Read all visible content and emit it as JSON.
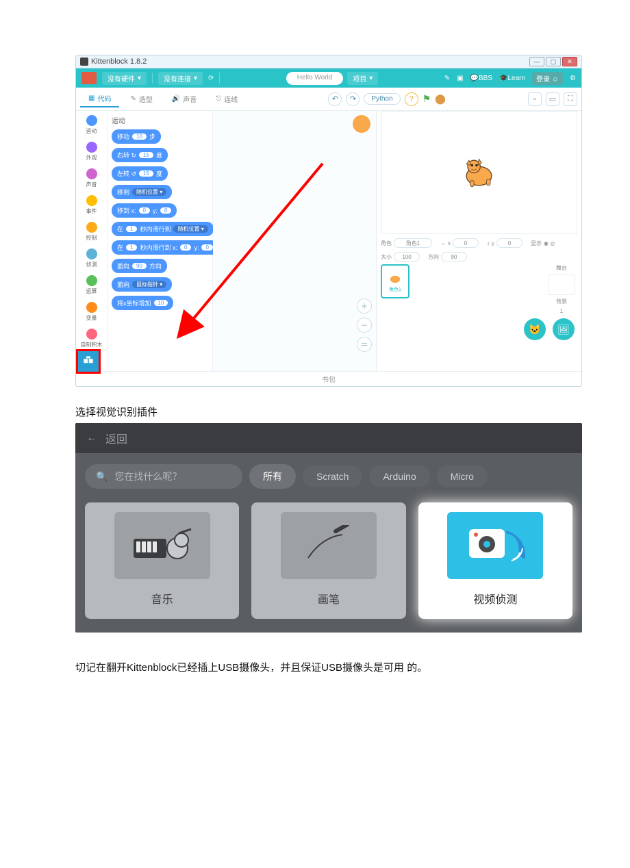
{
  "doc": {
    "text1": "选择视觉识别插件",
    "text2": "切记在翻开Kittenblock已经插上USB摄像头，并且保证USB摄像头是可用  的。"
  },
  "app": {
    "title": "Kittenblock 1.8.2",
    "toolbar": {
      "hardware": "没有硬件",
      "connect": "没有连接",
      "project_name": "Hello World",
      "project_menu": "项目",
      "bbs": "BBS",
      "learn": "Learn",
      "login": "登录"
    },
    "tabs": {
      "code": "代码",
      "costumes": "造型",
      "sounds": "声音",
      "wire": "连线",
      "python": "Python"
    },
    "categories": [
      {
        "name": "运动",
        "color": "#4c97ff"
      },
      {
        "name": "外观",
        "color": "#9966ff"
      },
      {
        "name": "声音",
        "color": "#cf63cf"
      },
      {
        "name": "事件",
        "color": "#ffbf00"
      },
      {
        "name": "控制",
        "color": "#ffab19"
      },
      {
        "name": "侦测",
        "color": "#5cb1d6"
      },
      {
        "name": "运算",
        "color": "#59c059"
      },
      {
        "name": "变量",
        "color": "#ff8c1a"
      },
      {
        "name": "自制积木",
        "color": "#ff6680"
      }
    ],
    "blocks_title": "运动",
    "blocks": {
      "move_label": "移动",
      "move_val": "10",
      "move_suffix": "步",
      "cw_label": "右转 ↻",
      "cw_val": "15",
      "cw_suffix": "度",
      "ccw_label": "左转 ↺",
      "ccw_val": "15",
      "ccw_suffix": "度",
      "goto_label": "移到",
      "goto_drop": "随机位置 ▾",
      "gotoxy_label": "移到 x:",
      "gotoxy_x": "0",
      "gotoxy_y_label": "y:",
      "gotoxy_y": "0",
      "glide_label": "在",
      "glide_secs": "1",
      "glide_mid": "秒内滑行到",
      "glide_drop": "随机位置 ▾",
      "glidexy_label": "在",
      "glidexy_secs": "1",
      "glidexy_mid": "秒内滑行到 x:",
      "glidexy_x": "0",
      "glidexy_y_label": "y:",
      "glidexy_y": "0",
      "point_label": "面向",
      "point_val": "90",
      "point_suffix": "方向",
      "point_to_label": "面向",
      "point_to_drop": "鼠标指针 ▾",
      "changex_label": "将x坐标增加",
      "changex_val": "10"
    },
    "sprite_panel": {
      "name_label": "角色",
      "name_val": "角色1",
      "x_label": "x",
      "x_val": "0",
      "y_label": "y",
      "y_val": "0",
      "show_label": "显示",
      "size_label": "大小",
      "size_val": "100",
      "dir_label": "方向",
      "dir_val": "90",
      "tile": "角色1",
      "stage_label": "舞台",
      "backdrop_label": "背景",
      "backdrop_count": "1"
    },
    "backpack": "书包"
  },
  "ext": {
    "back": "返回",
    "search_ph": "您在找什么呢？",
    "filters": {
      "all": "所有",
      "scratch": "Scratch",
      "arduino": "Arduino",
      "micro": "Micro"
    },
    "cards": {
      "music": "音乐",
      "pen": "画笔",
      "video": "视频侦测"
    }
  }
}
